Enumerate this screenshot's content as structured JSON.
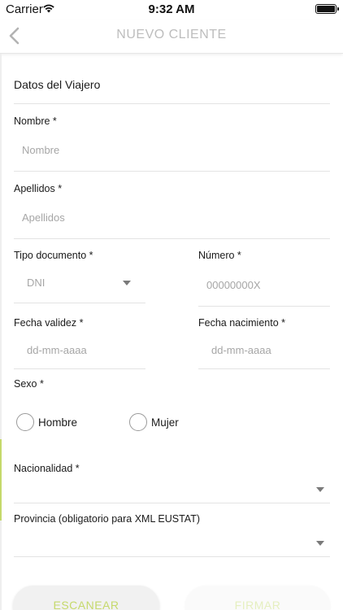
{
  "status_bar": {
    "carrier": "Carrier",
    "time": "9:32 AM"
  },
  "nav": {
    "title": "NUEVO CLIENTE"
  },
  "form": {
    "section_title": "Datos del Viajero",
    "nombre": {
      "label": "Nombre *",
      "placeholder": "Nombre",
      "value": ""
    },
    "apellidos": {
      "label": "Apellidos *",
      "placeholder": "Apellidos",
      "value": ""
    },
    "tipo_documento": {
      "label": "Tipo documento *",
      "selected": "DNI"
    },
    "numero": {
      "label": "Número *",
      "placeholder": "00000000X",
      "value": ""
    },
    "fecha_validez": {
      "label": "Fecha validez *",
      "placeholder": "dd-mm-aaaa",
      "value": ""
    },
    "fecha_nacimiento": {
      "label": "Fecha nacimiento *",
      "placeholder": "dd-mm-aaaa",
      "value": ""
    },
    "sexo": {
      "label": "Sexo *",
      "options": [
        "Hombre",
        "Mujer"
      ]
    },
    "nacionalidad": {
      "label": "Nacionalidad *",
      "selected": ""
    },
    "provincia": {
      "label": "Provincia (obligatorio para XML EUSTAT)",
      "selected": ""
    }
  },
  "actions": {
    "scan_label": "ESCANEAR",
    "sign_label": "FIRMAR"
  },
  "colors": {
    "accent": "#c5d96b",
    "accent_disabled": "#e5efbf",
    "title_gray": "#bdbdbd",
    "placeholder": "#a6a6a6"
  },
  "icons": {
    "back": "chevron-left-icon",
    "wifi": "wifi-icon",
    "battery": "battery-icon",
    "dropdown": "caret-down-icon"
  }
}
